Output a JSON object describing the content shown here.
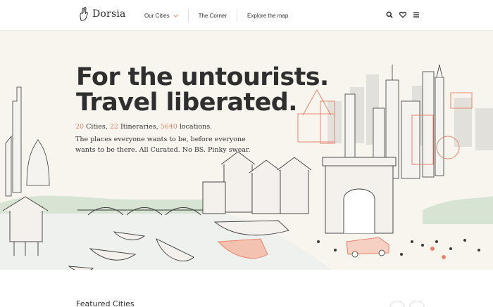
{
  "header": {
    "logo_text": "Dorsia",
    "nav": [
      {
        "label": "Our Cities",
        "has_dropdown": true
      },
      {
        "label": "The Corner",
        "has_dropdown": false
      },
      {
        "label": "Explore the map",
        "has_dropdown": false
      }
    ],
    "icons": [
      "search-icon",
      "heart-icon",
      "menu-icon"
    ]
  },
  "hero": {
    "title_line1": "For the untourists.",
    "title_line2": "Travel liberated.",
    "stats": {
      "cities_count": "20",
      "cities_label": " Cities, ",
      "itineraries_count": "22",
      "itineraries_label": " Itineraries, ",
      "locations_count": "5640",
      "locations_label": " locations."
    },
    "tagline": "The places everyone wants to be, before everyone wants to be there. All Curated. No BS. Pinky swear.",
    "accent_color": "#e8866a",
    "background_color": "#f8f5ee"
  },
  "featured": {
    "heading": "Featured Cities"
  }
}
